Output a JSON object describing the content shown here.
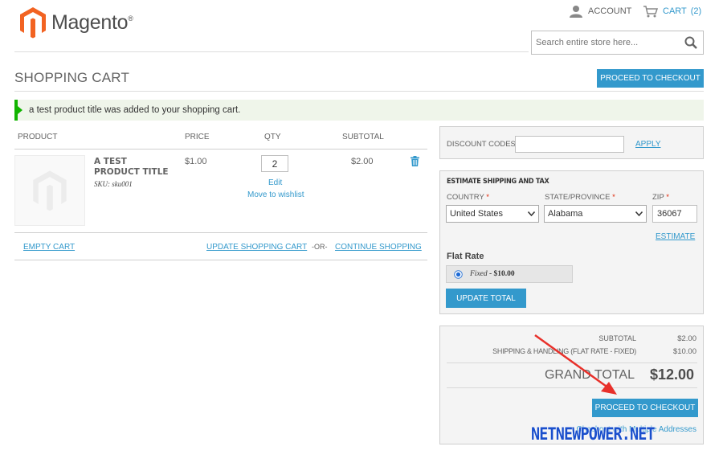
{
  "header": {
    "logo_text": "Magento",
    "logo_reg": "®",
    "account_label": "ACCOUNT",
    "cart_label": "CART",
    "cart_count": "(2)",
    "search_placeholder": "Search entire store here..."
  },
  "page": {
    "title": "SHOPPING CART",
    "checkout_top_label": "PROCEED TO CHECKOUT",
    "success_message": "a test product title was added to your shopping cart."
  },
  "cart": {
    "headers": {
      "product": "PRODUCT",
      "price": "PRICE",
      "qty": "QTY",
      "subtotal": "SUBTOTAL"
    },
    "item": {
      "name_line1": "A TEST",
      "name_line2": "PRODUCT TITLE",
      "sku": "SKU: sku001",
      "price": "$1.00",
      "qty": "2",
      "subtotal": "$2.00",
      "edit_label": "Edit",
      "wishlist_label": "Move to wishlist"
    },
    "actions": {
      "empty": "EMPTY CART",
      "update": "UPDATE SHOPPING CART",
      "or": "-OR-",
      "continue": "CONTINUE SHOPPING"
    }
  },
  "discount": {
    "label": "DISCOUNT CODES",
    "apply_label": "APPLY",
    "value": ""
  },
  "shipping": {
    "title": "ESTIMATE SHIPPING AND TAX",
    "country_label": "COUNTRY",
    "state_label": "STATE/PROVINCE",
    "zip_label": "ZIP",
    "required_mark": "*",
    "country_value": "United States",
    "state_value": "Alabama",
    "zip_value": "36067",
    "estimate_label": "ESTIMATE",
    "method_title": "Flat Rate",
    "method_label": "Fixed",
    "method_price": "- $10.00",
    "update_total_label": "UPDATE TOTAL"
  },
  "totals": {
    "subtotal_label": "SUBTOTAL",
    "subtotal_value": "$2.00",
    "shipping_label": "SHIPPING & HANDLING (FLAT RATE - FIXED)",
    "shipping_value": "$10.00",
    "grand_label": "GRAND TOTAL",
    "grand_value": "$12.00",
    "checkout_label": "PROCEED TO CHECKOUT",
    "multi_label": "Checkout with Multiple Addresses"
  },
  "watermark": {
    "text": "NETNEWPOWER.NET"
  },
  "colors": {
    "accent": "#3399cc",
    "success_bar": "#11b400",
    "arrow": "#e8302a",
    "watermark": "#1a4fcc"
  }
}
